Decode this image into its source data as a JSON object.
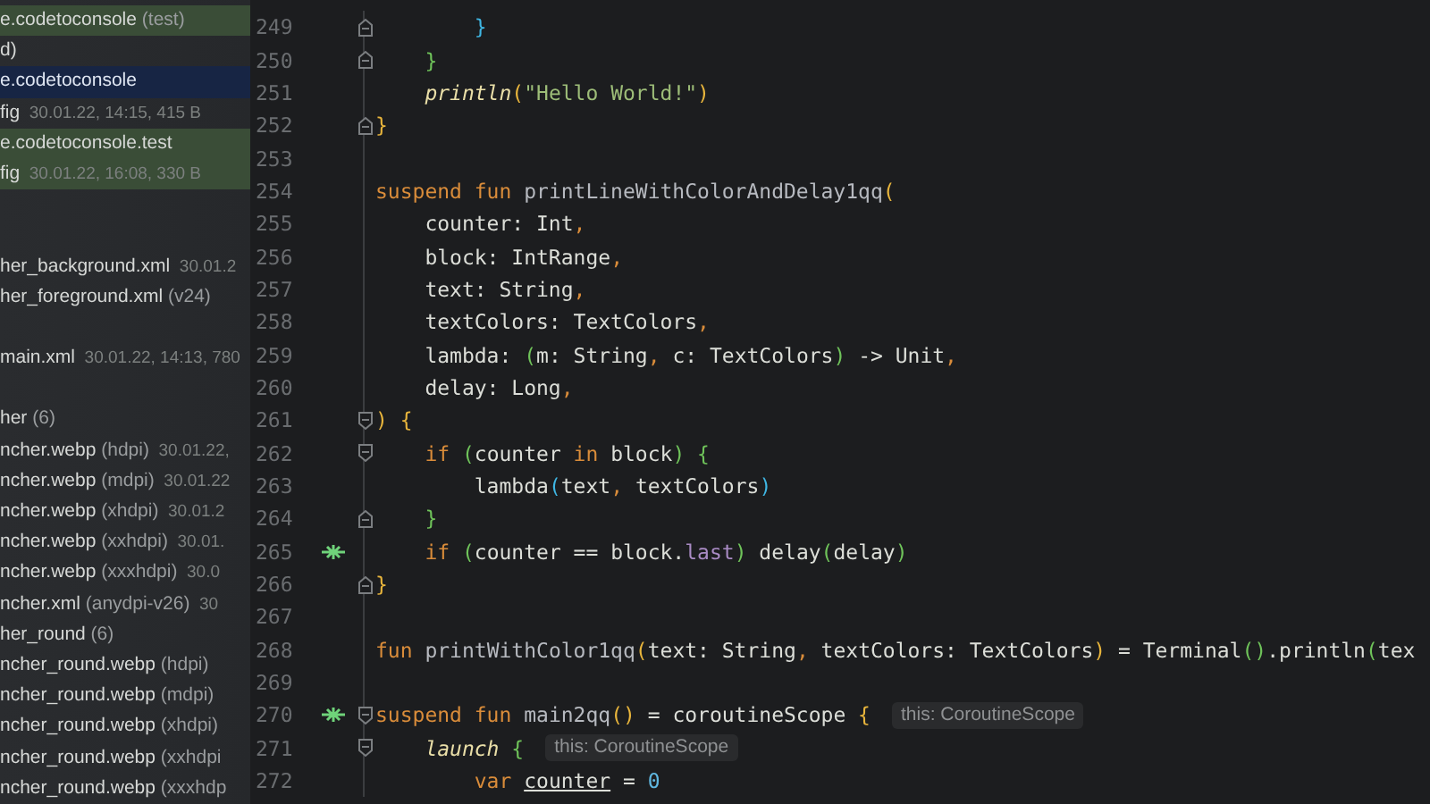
{
  "sidebar": {
    "items": [
      {
        "kind": "file",
        "name": "e.codetoconsole",
        "note": "(test)",
        "selected": false,
        "highlighted": true
      },
      {
        "kind": "file",
        "name": "d)",
        "selected": false,
        "highlighted": false
      },
      {
        "kind": "file",
        "name": "e.codetoconsole",
        "selected": true,
        "highlighted": false
      },
      {
        "kind": "file",
        "name": "fig",
        "meta": "30.01.22, 14:15, 415 B",
        "selected": false,
        "highlighted": false
      },
      {
        "kind": "file",
        "name": "e.codetoconsole.test",
        "selected": false,
        "highlighted": true
      },
      {
        "kind": "file",
        "name": "fig",
        "meta": "30.01.22, 16:08, 330 B",
        "selected": false,
        "highlighted": true
      },
      {
        "kind": "blank"
      },
      {
        "kind": "blank"
      },
      {
        "kind": "file",
        "name": "her_background.xml",
        "meta": "30.01.2",
        "selected": false,
        "highlighted": false
      },
      {
        "kind": "file",
        "name": "her_foreground.xml",
        "note": "(v24)",
        "selected": false,
        "highlighted": false
      },
      {
        "kind": "blank"
      },
      {
        "kind": "file",
        "name": "main.xml",
        "meta": "30.01.22, 14:13, 780",
        "selected": false,
        "highlighted": false
      },
      {
        "kind": "blank"
      },
      {
        "kind": "file",
        "name": "her",
        "note": "(6)",
        "selected": false,
        "highlighted": false
      },
      {
        "kind": "file",
        "name": "ncher.webp",
        "note": "(hdpi)",
        "meta": "30.01.22,",
        "selected": false,
        "highlighted": false
      },
      {
        "kind": "file",
        "name": "ncher.webp",
        "note": "(mdpi)",
        "meta": "30.01.22",
        "selected": false,
        "highlighted": false
      },
      {
        "kind": "file",
        "name": "ncher.webp",
        "note": "(xhdpi)",
        "meta": "30.01.2",
        "selected": false,
        "highlighted": false
      },
      {
        "kind": "file",
        "name": "ncher.webp",
        "note": "(xxhdpi)",
        "meta": "30.01.",
        "selected": false,
        "highlighted": false
      },
      {
        "kind": "file",
        "name": "ncher.webp",
        "note": "(xxxhdpi)",
        "meta": "30.0",
        "selected": false,
        "highlighted": false
      },
      {
        "kind": "file",
        "name": "ncher.xml",
        "note": "(anydpi-v26)",
        "meta": "30",
        "selected": false,
        "highlighted": false
      },
      {
        "kind": "file",
        "name": "her_round",
        "note": "(6)",
        "selected": false,
        "highlighted": false
      },
      {
        "kind": "file",
        "name": "ncher_round.webp",
        "note": "(hdpi)",
        "selected": false,
        "highlighted": false
      },
      {
        "kind": "file",
        "name": "ncher_round.webp",
        "note": "(mdpi)",
        "selected": false,
        "highlighted": false
      },
      {
        "kind": "file",
        "name": "ncher_round.webp",
        "note": "(xhdpi)",
        "selected": false,
        "highlighted": false
      },
      {
        "kind": "file",
        "name": "ncher_round.webp",
        "note": "(xxhdpi",
        "selected": false,
        "highlighted": false
      },
      {
        "kind": "file",
        "name": "ncher_round.webp",
        "note": "(xxxhdp",
        "selected": false,
        "highlighted": false
      }
    ]
  },
  "editor": {
    "lines": [
      {
        "number": "249",
        "marker": false,
        "fold_open": false,
        "tokens": [
          {
            "kind": "brace3",
            "text": "        }"
          }
        ]
      },
      {
        "number": "250",
        "marker": false,
        "fold_open": false,
        "tokens": [
          {
            "kind": "brace2",
            "text": "    }"
          }
        ]
      },
      {
        "number": "251",
        "marker": false,
        "tokens": [
          {
            "kind": "call",
            "text": "    println"
          },
          {
            "kind": "brace1",
            "text": "("
          },
          {
            "kind": "string",
            "text": "\"Hello World!\""
          },
          {
            "kind": "brace1",
            "text": ")"
          }
        ]
      },
      {
        "number": "252",
        "marker": false,
        "fold_open": false,
        "tokens": [
          {
            "kind": "brace1",
            "text": "}"
          }
        ]
      },
      {
        "number": "253",
        "marker": false
      },
      {
        "number": "254",
        "marker": false,
        "tokens": [
          {
            "kind": "keyword",
            "text": "suspend fun "
          },
          {
            "kind": "decl",
            "text": "printLineWithColorAndDelay1qq"
          },
          {
            "kind": "brace1",
            "text": "("
          }
        ]
      },
      {
        "number": "255",
        "marker": false,
        "tokens": [
          {
            "kind": "plain",
            "text": "    counter: Int"
          },
          {
            "kind": "punct",
            "text": ","
          }
        ]
      },
      {
        "number": "256",
        "marker": false,
        "tokens": [
          {
            "kind": "plain",
            "text": "    block: IntRange"
          },
          {
            "kind": "punct",
            "text": ","
          }
        ]
      },
      {
        "number": "257",
        "marker": false,
        "tokens": [
          {
            "kind": "plain",
            "text": "    text: String"
          },
          {
            "kind": "punct",
            "text": ","
          }
        ]
      },
      {
        "number": "258",
        "marker": false,
        "tokens": [
          {
            "kind": "plain",
            "text": "    textColors: TextColors"
          },
          {
            "kind": "punct",
            "text": ","
          }
        ]
      },
      {
        "number": "259",
        "marker": false,
        "tokens": [
          {
            "kind": "plain",
            "text": "    lambda: "
          },
          {
            "kind": "brace2",
            "text": "("
          },
          {
            "kind": "plain",
            "text": "m: String"
          },
          {
            "kind": "punct",
            "text": ","
          },
          {
            "kind": "plain",
            "text": " c: TextColors"
          },
          {
            "kind": "brace2",
            "text": ")"
          },
          {
            "kind": "plain",
            "text": " -> Unit"
          },
          {
            "kind": "punct",
            "text": ","
          }
        ]
      },
      {
        "number": "260",
        "marker": false,
        "tokens": [
          {
            "kind": "plain",
            "text": "    delay: Long"
          },
          {
            "kind": "punct",
            "text": ","
          }
        ]
      },
      {
        "number": "261",
        "marker": false,
        "fold_open": true,
        "tokens": [
          {
            "kind": "brace1",
            "text": ") {"
          }
        ]
      },
      {
        "number": "262",
        "marker": false,
        "fold_open": true,
        "tokens": [
          {
            "kind": "keyword",
            "text": "    if "
          },
          {
            "kind": "brace2",
            "text": "("
          },
          {
            "kind": "plain",
            "text": "counter "
          },
          {
            "kind": "keyword",
            "text": "in"
          },
          {
            "kind": "plain",
            "text": " block"
          },
          {
            "kind": "brace2",
            "text": ") {"
          }
        ]
      },
      {
        "number": "263",
        "marker": false,
        "tokens": [
          {
            "kind": "plain",
            "text": "        lambda"
          },
          {
            "kind": "brace3",
            "text": "("
          },
          {
            "kind": "plain",
            "text": "text"
          },
          {
            "kind": "punct",
            "text": ","
          },
          {
            "kind": "plain",
            "text": " textColors"
          },
          {
            "kind": "brace3",
            "text": ")"
          }
        ]
      },
      {
        "number": "264",
        "marker": false,
        "fold_open": false,
        "tokens": [
          {
            "kind": "brace2",
            "text": "    }"
          }
        ]
      },
      {
        "number": "265",
        "marker": true,
        "tokens": [
          {
            "kind": "keyword",
            "text": "    if "
          },
          {
            "kind": "brace2",
            "text": "("
          },
          {
            "kind": "plain",
            "text": "counter == block."
          },
          {
            "kind": "property",
            "text": "last"
          },
          {
            "kind": "brace2",
            "text": ")"
          },
          {
            "kind": "plain",
            "text": " delay"
          },
          {
            "kind": "brace2",
            "text": "("
          },
          {
            "kind": "plain",
            "text": "delay"
          },
          {
            "kind": "brace2",
            "text": ")"
          }
        ]
      },
      {
        "number": "266",
        "marker": false,
        "fold_open": false,
        "tokens": [
          {
            "kind": "brace1",
            "text": "}"
          }
        ]
      },
      {
        "number": "267",
        "marker": false
      },
      {
        "number": "268",
        "marker": false,
        "tokens": [
          {
            "kind": "keyword",
            "text": "fun "
          },
          {
            "kind": "decl",
            "text": "printWithColor1qq"
          },
          {
            "kind": "brace1",
            "text": "("
          },
          {
            "kind": "plain",
            "text": "text: String"
          },
          {
            "kind": "punct",
            "text": ","
          },
          {
            "kind": "plain",
            "text": " textColors: TextColors"
          },
          {
            "kind": "brace1",
            "text": ")"
          },
          {
            "kind": "plain",
            "text": " = Terminal"
          },
          {
            "kind": "brace2",
            "text": "()"
          },
          {
            "kind": "plain",
            "text": ".println"
          },
          {
            "kind": "brace2",
            "text": "("
          },
          {
            "kind": "plain",
            "text": "tex"
          }
        ]
      },
      {
        "number": "269",
        "marker": false
      },
      {
        "number": "270",
        "marker": true,
        "fold_open": true,
        "tokens": [
          {
            "kind": "keyword",
            "text": "suspend fun "
          },
          {
            "kind": "decl",
            "text": "main2qq"
          },
          {
            "kind": "brace1",
            "text": "()"
          },
          {
            "kind": "plain",
            "text": " = coroutineScope "
          },
          {
            "kind": "brace1",
            "text": "{"
          },
          {
            "kind": "hint",
            "text": "this: CoroutineScope"
          }
        ]
      },
      {
        "number": "271",
        "marker": false,
        "fold_open": true,
        "tokens": [
          {
            "kind": "call",
            "text": "    launch"
          },
          {
            "kind": "brace2",
            "text": " {"
          },
          {
            "kind": "hint",
            "text": "this: CoroutineScope"
          }
        ]
      },
      {
        "number": "272",
        "marker": false,
        "tokens": [
          {
            "kind": "keyword",
            "text": "        var "
          },
          {
            "kind": "underline",
            "text": "counter"
          },
          {
            "kind": "plain",
            "text": " = "
          },
          {
            "kind": "number",
            "text": "0"
          }
        ]
      }
    ]
  }
}
